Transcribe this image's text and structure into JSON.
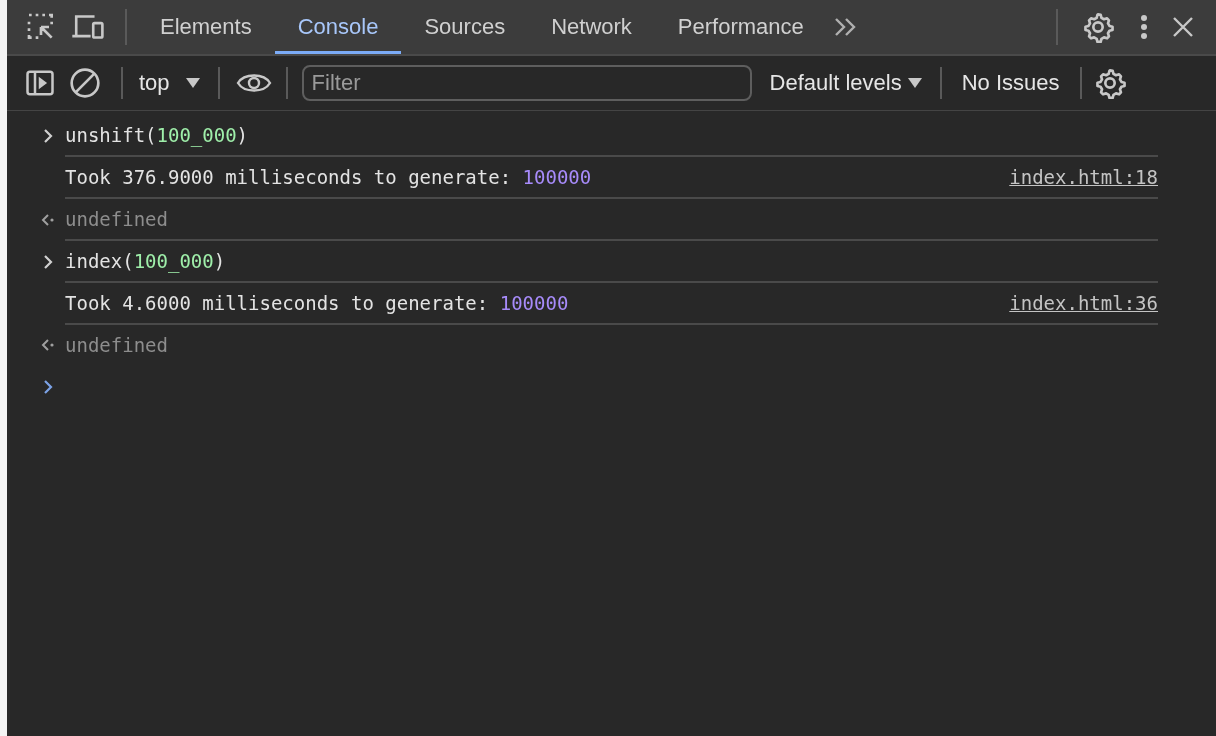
{
  "tabs": [
    {
      "label": "Elements",
      "selected": false
    },
    {
      "label": "Console",
      "selected": true
    },
    {
      "label": "Sources",
      "selected": false
    },
    {
      "label": "Network",
      "selected": false
    },
    {
      "label": "Performance",
      "selected": false
    }
  ],
  "console_toolbar": {
    "context": "top",
    "filter": {
      "placeholder": "Filter"
    },
    "levels": "Default levels",
    "issues": "No Issues"
  },
  "entries": [
    {
      "kind": "input",
      "parts": [
        {
          "kind": "code",
          "text": "unshift("
        },
        {
          "kind": "number",
          "text": "100_000"
        },
        {
          "kind": "code",
          "text": ")"
        }
      ]
    },
    {
      "kind": "log",
      "parts": [
        {
          "kind": "code",
          "text": "Took 376.9000 milliseconds to generate: "
        },
        {
          "kind": "value",
          "text": "100000"
        }
      ],
      "source": "index.html:18"
    },
    {
      "kind": "result",
      "parts": [
        {
          "kind": "code",
          "text": "undefined"
        }
      ]
    },
    {
      "kind": "input",
      "parts": [
        {
          "kind": "code",
          "text": "index("
        },
        {
          "kind": "number",
          "text": "100_000"
        },
        {
          "kind": "code",
          "text": ")"
        }
      ]
    },
    {
      "kind": "log",
      "parts": [
        {
          "kind": "code",
          "text": "Took 4.6000 milliseconds to generate: "
        },
        {
          "kind": "value",
          "text": "100000"
        }
      ],
      "source": "index.html:36"
    },
    {
      "kind": "result",
      "parts": [
        {
          "kind": "code",
          "text": "undefined"
        }
      ]
    }
  ]
}
